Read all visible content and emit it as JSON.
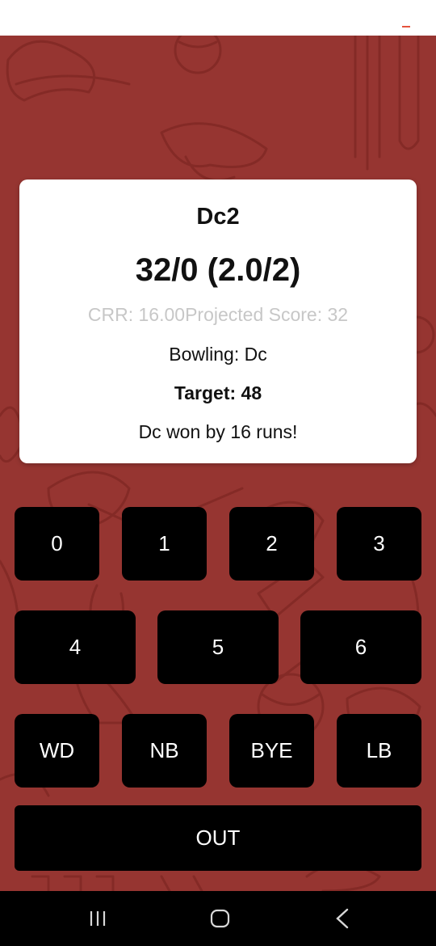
{
  "status_bar": {
    "menu_icon": "menu-dash-icon"
  },
  "scorecard": {
    "team": "Dc2",
    "score": "32/0 (2.0/2)",
    "rates": "CRR: 16.00Projected Score: 32",
    "bowling": "Bowling: Dc",
    "target": "Target: 48",
    "result": "Dc won by 16 runs!"
  },
  "keypad": {
    "runs_row1": [
      "0",
      "1",
      "2",
      "3"
    ],
    "runs_row2": [
      "4",
      "5",
      "6"
    ],
    "extras": [
      "WD",
      "NB",
      "BYE",
      "LB"
    ],
    "out": "OUT"
  },
  "nav_bar": {
    "recents_icon": "recent-apps-icon",
    "home_icon": "home-icon",
    "back_icon": "back-icon"
  },
  "colors": {
    "background": "#963531",
    "pattern_stroke": "#8a2c28",
    "card": "#ffffff",
    "key": "#000000",
    "accent": "#e5533d"
  }
}
